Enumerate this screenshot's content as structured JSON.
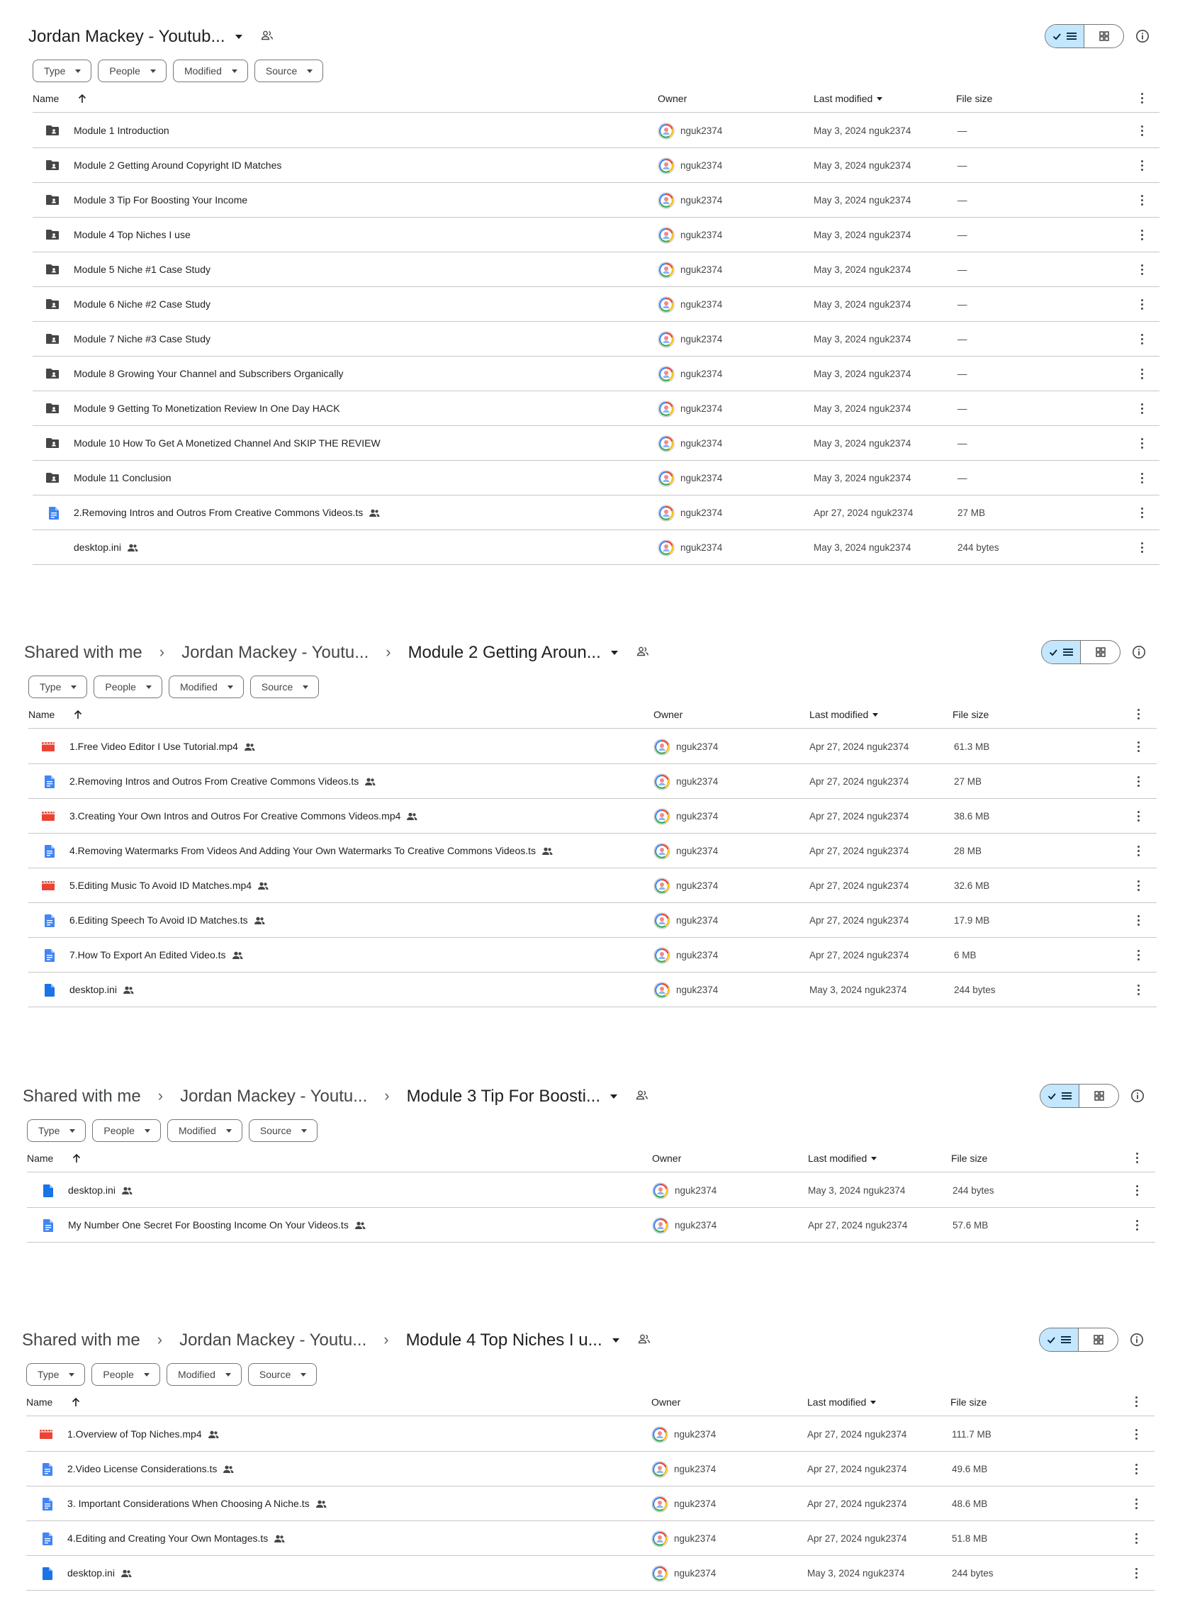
{
  "colors": {
    "accent": "#c2e7ff",
    "folder": "#444746",
    "doc": "#4285f4",
    "video": "#ea4335",
    "border": "#747775",
    "divider": "#c7c7c7"
  },
  "filters": [
    "Type",
    "People",
    "Modified",
    "Source"
  ],
  "columns": {
    "name": "Name",
    "owner": "Owner",
    "modified": "Last modified",
    "size": "File size"
  },
  "panels": [
    {
      "title": {
        "crumbs": [],
        "current": "Jordan Mackey - Youtub..."
      },
      "rows": [
        {
          "icon": "folder",
          "name": "Module 1 Introduction",
          "shared": false,
          "owner": "nguk2374",
          "modified": "May 3, 2024 nguk2374",
          "size": "—"
        },
        {
          "icon": "folder",
          "name": "Module 2 Getting Around Copyright ID Matches",
          "shared": false,
          "owner": "nguk2374",
          "modified": "May 3, 2024 nguk2374",
          "size": "—"
        },
        {
          "icon": "folder",
          "name": "Module 3 Tip For Boosting Your Income",
          "shared": false,
          "owner": "nguk2374",
          "modified": "May 3, 2024 nguk2374",
          "size": "—"
        },
        {
          "icon": "folder",
          "name": "Module 4 Top Niches I use",
          "shared": false,
          "owner": "nguk2374",
          "modified": "May 3, 2024 nguk2374",
          "size": "—"
        },
        {
          "icon": "folder",
          "name": "Module 5 Niche #1 Case Study",
          "shared": false,
          "owner": "nguk2374",
          "modified": "May 3, 2024 nguk2374",
          "size": "—"
        },
        {
          "icon": "folder",
          "name": "Module 6 Niche #2 Case Study",
          "shared": false,
          "owner": "nguk2374",
          "modified": "May 3, 2024 nguk2374",
          "size": "—"
        },
        {
          "icon": "folder",
          "name": "Module 7 Niche #3 Case Study",
          "shared": false,
          "owner": "nguk2374",
          "modified": "May 3, 2024 nguk2374",
          "size": "—"
        },
        {
          "icon": "folder",
          "name": "Module 8 Growing Your Channel and Subscribers Organically",
          "shared": false,
          "owner": "nguk2374",
          "modified": "May 3, 2024 nguk2374",
          "size": "—"
        },
        {
          "icon": "folder",
          "name": "Module 9 Getting To Monetization Review In One Day HACK",
          "shared": false,
          "owner": "nguk2374",
          "modified": "May 3, 2024 nguk2374",
          "size": "—"
        },
        {
          "icon": "folder",
          "name": "Module 10 How To Get A Monetized Channel And SKIP THE REVIEW",
          "shared": false,
          "owner": "nguk2374",
          "modified": "May 3, 2024 nguk2374",
          "size": "—"
        },
        {
          "icon": "folder",
          "name": "Module 11 Conclusion",
          "shared": false,
          "owner": "nguk2374",
          "modified": "May 3, 2024 nguk2374",
          "size": "—"
        },
        {
          "icon": "doc",
          "name": "2.Removing Intros and Outros From Creative Commons Videos.ts",
          "shared": true,
          "owner": "nguk2374",
          "modified": "Apr 27, 2024 nguk2374",
          "size": "27 MB"
        },
        {
          "icon": "none",
          "name": "desktop.ini",
          "shared": true,
          "owner": "nguk2374",
          "modified": "May 3, 2024 nguk2374",
          "size": "244 bytes"
        }
      ]
    },
    {
      "title": {
        "crumbs": [
          "Shared with me",
          "Jordan Mackey - Youtu..."
        ],
        "current": "Module 2 Getting Aroun..."
      },
      "rows": [
        {
          "icon": "video",
          "name": "1.Free Video Editor I Use Tutorial.mp4",
          "shared": true,
          "owner": "nguk2374",
          "modified": "Apr 27, 2024 nguk2374",
          "size": "61.3 MB"
        },
        {
          "icon": "doc",
          "name": "2.Removing Intros and Outros From Creative Commons Videos.ts",
          "shared": true,
          "owner": "nguk2374",
          "modified": "Apr 27, 2024 nguk2374",
          "size": "27 MB"
        },
        {
          "icon": "video",
          "name": "3.Creating Your Own Intros and Outros For Creative Commons Videos.mp4",
          "shared": true,
          "owner": "nguk2374",
          "modified": "Apr 27, 2024 nguk2374",
          "size": "38.6 MB"
        },
        {
          "icon": "doc",
          "name": "4.Removing Watermarks From Videos And Adding Your Own Watermarks To Creative Commons Videos.ts",
          "shared": true,
          "owner": "nguk2374",
          "modified": "Apr 27, 2024 nguk2374",
          "size": "28 MB"
        },
        {
          "icon": "video",
          "name": "5.Editing Music To Avoid ID Matches.mp4",
          "shared": true,
          "owner": "nguk2374",
          "modified": "Apr 27, 2024 nguk2374",
          "size": "32.6 MB"
        },
        {
          "icon": "doc",
          "name": "6.Editing Speech To Avoid ID Matches.ts",
          "shared": true,
          "owner": "nguk2374",
          "modified": "Apr 27, 2024 nguk2374",
          "size": "17.9 MB"
        },
        {
          "icon": "doc",
          "name": "7.How To Export An Edited Video.ts",
          "shared": true,
          "owner": "nguk2374",
          "modified": "Apr 27, 2024 nguk2374",
          "size": "6 MB"
        },
        {
          "icon": "file",
          "name": "desktop.ini",
          "shared": true,
          "owner": "nguk2374",
          "modified": "May 3, 2024 nguk2374",
          "size": "244 bytes"
        }
      ]
    },
    {
      "title": {
        "crumbs": [
          "Shared with me",
          "Jordan Mackey - Youtu..."
        ],
        "current": "Module 3 Tip For Boosti..."
      },
      "rows": [
        {
          "icon": "file",
          "name": "desktop.ini",
          "shared": true,
          "owner": "nguk2374",
          "modified": "May 3, 2024 nguk2374",
          "size": "244 bytes"
        },
        {
          "icon": "doc",
          "name": "My Number One Secret For Boosting Income On Your Videos.ts",
          "shared": true,
          "owner": "nguk2374",
          "modified": "Apr 27, 2024 nguk2374",
          "size": "57.6 MB"
        }
      ]
    },
    {
      "title": {
        "crumbs": [
          "Shared with me",
          "Jordan Mackey - Youtu..."
        ],
        "current": "Module 4 Top Niches I u..."
      },
      "rows": [
        {
          "icon": "video",
          "name": "1.Overview of Top Niches.mp4",
          "shared": true,
          "owner": "nguk2374",
          "modified": "Apr 27, 2024 nguk2374",
          "size": "111.7 MB"
        },
        {
          "icon": "doc",
          "name": "2.Video License Considerations.ts",
          "shared": true,
          "owner": "nguk2374",
          "modified": "Apr 27, 2024 nguk2374",
          "size": "49.6 MB"
        },
        {
          "icon": "doc",
          "name": "3. Important Considerations When Choosing A Niche.ts",
          "shared": true,
          "owner": "nguk2374",
          "modified": "Apr 27, 2024 nguk2374",
          "size": "48.6 MB"
        },
        {
          "icon": "doc",
          "name": "4.Editing and Creating Your Own Montages.ts",
          "shared": true,
          "owner": "nguk2374",
          "modified": "Apr 27, 2024 nguk2374",
          "size": "51.8 MB"
        },
        {
          "icon": "file",
          "name": "desktop.ini",
          "shared": true,
          "owner": "nguk2374",
          "modified": "May 3, 2024 nguk2374",
          "size": "244 bytes"
        }
      ]
    }
  ]
}
